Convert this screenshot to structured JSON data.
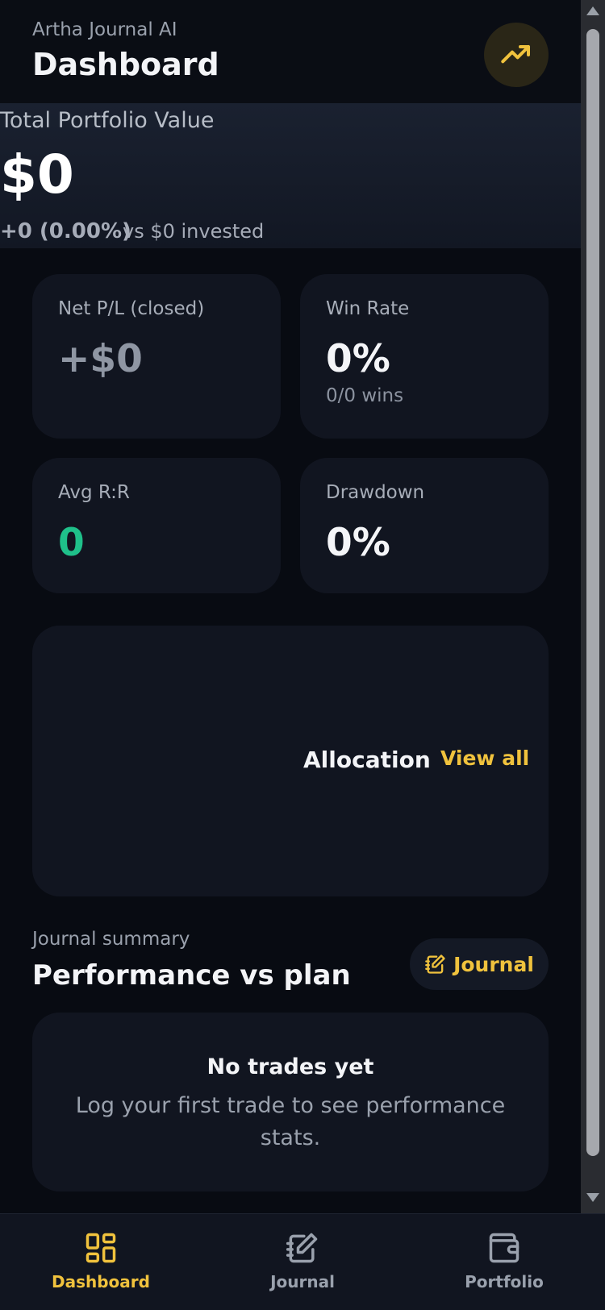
{
  "header": {
    "app_name": "Artha Journal AI",
    "title": "Dashboard",
    "trend_icon": "trending-up-icon"
  },
  "portfolio": {
    "label": "Total Portfolio Value",
    "value": "$0",
    "change": "+0 (0.00%)",
    "invested": "vs $0 invested"
  },
  "stats": [
    {
      "label": "Net P/L (closed)",
      "value": "+$0",
      "sub": "",
      "value_color": "#8f96a3"
    },
    {
      "label": "Win Rate",
      "value": "0%",
      "sub": "0/0 wins",
      "value_color": "#f4f5f8"
    },
    {
      "label": "Avg R:R",
      "value": "0",
      "sub": "",
      "value_color": "#1fc08a"
    },
    {
      "label": "Drawdown",
      "value": "0%",
      "sub": "",
      "value_color": "#f4f5f8"
    }
  ],
  "allocation": {
    "title": "Allocation",
    "link": "View all"
  },
  "journal_summary": {
    "label": "Journal summary",
    "title": "Performance vs plan",
    "button": "Journal",
    "empty_title": "No trades yet",
    "empty_text": "Log your first trade to see performance stats."
  },
  "nav": [
    {
      "label": "Dashboard",
      "icon": "dashboard-grid-icon",
      "active": true
    },
    {
      "label": "Journal",
      "icon": "journal-notebook-icon",
      "active": false
    },
    {
      "label": "Portfolio",
      "icon": "wallet-icon",
      "active": false
    }
  ],
  "colors": {
    "accent": "#f0c23d",
    "positive": "#1fc08a",
    "inactive": "#9aa1ad",
    "background": "#080b12",
    "card": "#111520"
  }
}
